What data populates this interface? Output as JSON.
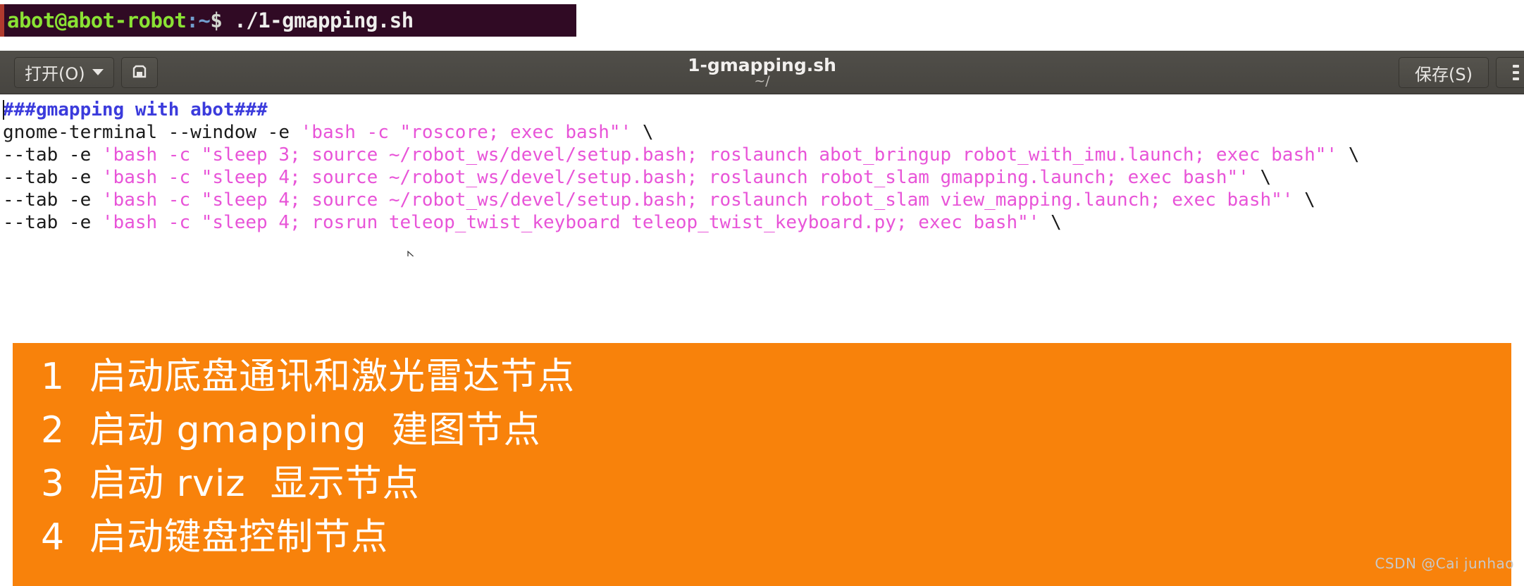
{
  "terminal": {
    "user_host": "abot@abot-robot",
    "separator": ":",
    "path": "~",
    "prompt_symbol": "$",
    "command": "./1-gmapping.sh"
  },
  "editor": {
    "title": "1-gmapping.sh",
    "subtitle": "~/",
    "open_button_label": "打开(O)",
    "save_as_icon": "save-as-icon",
    "save_button_label": "保存(S)",
    "menu_icon": "hamburger-menu-icon",
    "caret_icon": "chevron-down-icon"
  },
  "code": {
    "lines": [
      {
        "tokens": [
          {
            "text": "###gmapping with abot###",
            "type": "comment"
          }
        ]
      },
      {
        "tokens": [
          {
            "text": "gnome-terminal --window -e ",
            "type": "plain"
          },
          {
            "text": "'bash -c \"roscore; exec bash\"'",
            "type": "string"
          },
          {
            "text": " \\",
            "type": "plain"
          }
        ]
      },
      {
        "tokens": [
          {
            "text": "--tab -e ",
            "type": "plain"
          },
          {
            "text": "'bash -c \"sleep 3; source ~/robot_ws/devel/setup.bash; roslaunch abot_bringup robot_with_imu.launch; exec bash\"'",
            "type": "string"
          },
          {
            "text": " \\",
            "type": "plain"
          }
        ]
      },
      {
        "tokens": [
          {
            "text": "--tab -e ",
            "type": "plain"
          },
          {
            "text": "'bash -c \"sleep 4; source ~/robot_ws/devel/setup.bash; roslaunch robot_slam gmapping.launch; exec bash\"'",
            "type": "string"
          },
          {
            "text": " \\",
            "type": "plain"
          }
        ]
      },
      {
        "tokens": [
          {
            "text": "--tab -e ",
            "type": "plain"
          },
          {
            "text": "'bash -c \"sleep 4; source ~/robot_ws/devel/setup.bash; roslaunch robot_slam view_mapping.launch; exec bash\"'",
            "type": "string"
          },
          {
            "text": " \\",
            "type": "plain"
          }
        ]
      },
      {
        "tokens": [
          {
            "text": "--tab -e ",
            "type": "plain"
          },
          {
            "text": "'bash -c \"sleep 4; rosrun teleop_twist_keyboard teleop_twist_keyboard.py; exec bash\"'",
            "type": "string"
          },
          {
            "text": " \\",
            "type": "plain"
          }
        ]
      }
    ]
  },
  "annotation": {
    "background_color": "#f8820b",
    "text_color": "#ffffff",
    "lines": [
      "1  启动底盘通讯和激光雷达节点",
      "2  启动 gmapping  建图节点",
      "3  启动 rviz  显示节点",
      "4  启动键盘控制节点"
    ]
  },
  "watermark": {
    "text": "CSDN @Cai junhao"
  },
  "colors": {
    "terminal_background": "#300a24",
    "terminal_border": "#b03a2e",
    "terminal_user": "#8ae234",
    "terminal_path": "#729fcf",
    "headerbar": "#4a4843",
    "comment": "#3b3bdc",
    "string": "#e854d8"
  }
}
